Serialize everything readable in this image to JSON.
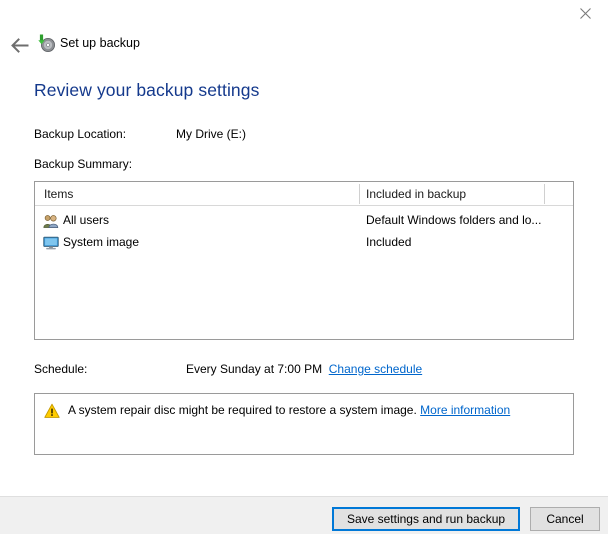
{
  "window": {
    "close_icon": "close-icon",
    "back_icon": "back-arrow-icon",
    "wizard_icon": "backup-disc-icon",
    "wizard_title": "Set up backup"
  },
  "page": {
    "heading": "Review your backup settings"
  },
  "fields": {
    "location_label": "Backup Location:",
    "location_value": "My Drive (E:)",
    "summary_label": "Backup Summary:",
    "schedule_label": "Schedule:",
    "schedule_value": "Every Sunday at 7:00 PM",
    "schedule_link": "Change schedule"
  },
  "table": {
    "headers": [
      "Items",
      "Included in backup"
    ],
    "rows": [
      {
        "icon": "users-icon",
        "item": "All users",
        "included": "Default Windows folders and lo..."
      },
      {
        "icon": "monitor-icon",
        "item": "System image",
        "included": "Included"
      }
    ]
  },
  "warning": {
    "icon": "warning-triangle-icon",
    "text": "A system repair disc might be required to restore a system image.",
    "link": "More information"
  },
  "footer": {
    "primary_button": "Save settings and run backup",
    "cancel_button": "Cancel"
  },
  "colors": {
    "heading": "#14398c",
    "link": "#0066cc",
    "focus_border": "#0078d7",
    "footer_bg": "#f0f0f0"
  }
}
